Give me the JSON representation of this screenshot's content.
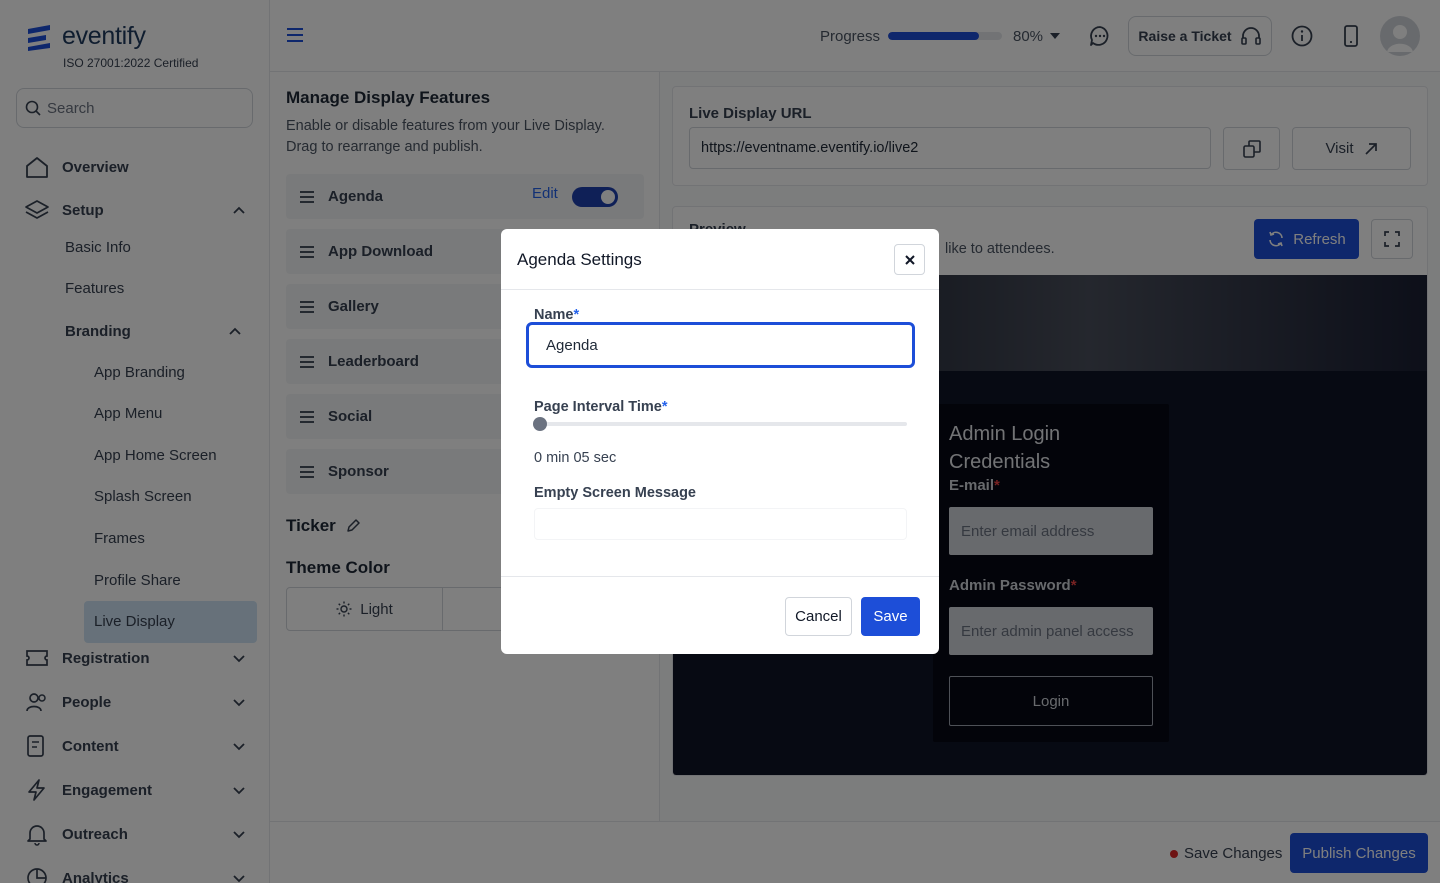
{
  "brand": {
    "name": "eventify",
    "certification": "ISO 27001:2022 Certified"
  },
  "sidebar": {
    "search_placeholder": "Search",
    "overview": "Overview",
    "setup": "Setup",
    "basic_info": "Basic Info",
    "features": "Features",
    "branding": "Branding",
    "branding_items": [
      "App Branding",
      "App Menu",
      "App Home Screen",
      "Splash Screen",
      "Frames",
      "Profile Share",
      "Live Display"
    ],
    "registration": "Registration",
    "people": "People",
    "content": "Content",
    "engagement": "Engagement",
    "outreach": "Outreach",
    "analytics": "Analytics"
  },
  "header": {
    "progress_label": "Progress",
    "progress_value": 80,
    "progress_text": "80%",
    "raise_ticket": "Raise a Ticket"
  },
  "manage": {
    "title": "Manage Display Features",
    "description": "Enable or disable features from your Live Display. Drag to rearrange and publish.",
    "features": [
      "Agenda",
      "App Download",
      "Gallery",
      "Leaderboard",
      "Social",
      "Sponsor"
    ],
    "edit_label": "Edit",
    "ticker": "Ticker",
    "theme_title": "Theme Color",
    "theme_light": "Light"
  },
  "live_url": {
    "label": "Live Display URL",
    "value": "https://eventname.eventify.io/live2",
    "visit": "Visit"
  },
  "preview": {
    "title": "Preview",
    "description": "like to attendees.",
    "refresh": "Refresh",
    "login": {
      "title": "Admin Login Credentials",
      "email_label": "E-mail",
      "email_placeholder": "Enter email address",
      "password_label": "Admin Password",
      "password_placeholder": "Enter admin panel access",
      "button": "Login"
    }
  },
  "footer": {
    "save_changes": "Save Changes",
    "publish": "Publish Changes"
  },
  "modal": {
    "title": "Agenda Settings",
    "name_label": "Name",
    "name_value": "Agenda",
    "interval_label": "Page Interval Time",
    "interval_value": 0,
    "interval_text": "0 min 05 sec",
    "empty_label": "Empty Screen Message",
    "cancel": "Cancel",
    "save": "Save"
  },
  "colors": {
    "primary": "#1d4ed8",
    "active_nav": "#cfe3f5",
    "required": "#2563eb"
  },
  "icons": [
    "menu-icon",
    "chat-icon",
    "headset-icon",
    "info-icon",
    "mobile-icon",
    "user-icon",
    "copy-icon",
    "external-link-icon",
    "refresh-icon",
    "expand-icon",
    "close-icon",
    "drag-handle-icon",
    "pencil-icon",
    "sun-icon",
    "moon-icon"
  ]
}
